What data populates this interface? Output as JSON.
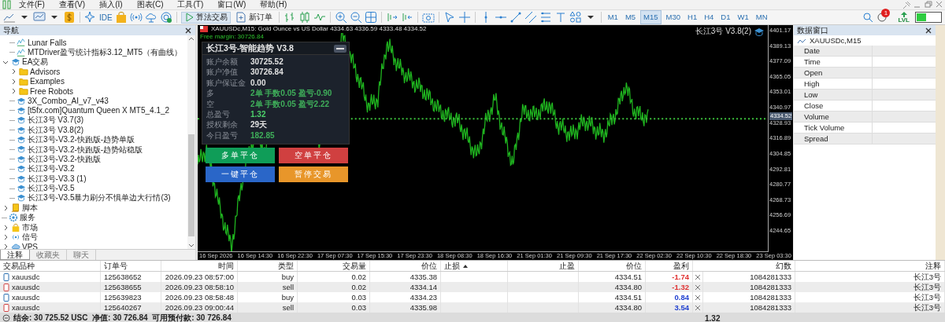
{
  "menu": [
    "文件(F)",
    "查看(V)",
    "插入(I)",
    "图表(C)",
    "工具(T)",
    "窗口(W)",
    "帮助(H)"
  ],
  "toolbar": {
    "ide": "IDE",
    "algo_trading": {
      "label": "算法交易",
      "on": true
    },
    "new_order": "新订单",
    "timeframes": [
      {
        "label": "M1",
        "selected": false
      },
      {
        "label": "M5",
        "selected": false
      },
      {
        "label": "M15",
        "selected": true
      },
      {
        "label": "M30",
        "selected": false
      },
      {
        "label": "H1",
        "selected": false
      },
      {
        "label": "H4",
        "selected": false
      },
      {
        "label": "D1",
        "selected": false
      },
      {
        "label": "W1",
        "selected": false
      },
      {
        "label": "MN",
        "selected": false
      }
    ],
    "notifications": "1",
    "level_badge": "LVL"
  },
  "navigator": {
    "title": "导航",
    "tree_continued": [
      {
        "label": "Lunar Falls",
        "kind": "indicator"
      },
      {
        "label": "MTDriver盈亏统计指标3.12_MT5（有曲线）",
        "kind": "indicator"
      }
    ],
    "tree": [
      {
        "label": "EA交易",
        "kind": "ea",
        "expanded": true,
        "children": [
          {
            "label": "Advisors",
            "kind": "folder",
            "expanded": false
          },
          {
            "label": "Examples",
            "kind": "folder",
            "expanded": false
          },
          {
            "label": "Free Robots",
            "kind": "folder",
            "expanded": false
          },
          {
            "label": "3X_Combo_AI_v7_v43",
            "kind": "ea"
          },
          {
            "label": "[t5fx.com]Quantum Queen X MT5_4.1_2",
            "kind": "ea"
          },
          {
            "label": "长江3号 V3.7(3)",
            "kind": "ea"
          },
          {
            "label": "长江3号 V3.8(2)",
            "kind": "ea"
          },
          {
            "label": "长江3号-V3.2-快跑版-趋势单版",
            "kind": "ea"
          },
          {
            "label": "长江3号-V3.2-快跑版-趋势站稳版",
            "kind": "ea"
          },
          {
            "label": "长江3号-V3.2-快跑版",
            "kind": "ea"
          },
          {
            "label": "长江3号-V3.2",
            "kind": "ea"
          },
          {
            "label": "长江3号-V3.3 (1)",
            "kind": "ea"
          },
          {
            "label": "长江3号-V3.5",
            "kind": "ea"
          },
          {
            "label": "长江3号-V3.5暴力刷分不惧单边大行情(3)",
            "kind": "ea"
          }
        ]
      },
      {
        "label": "脚本",
        "kind": "script",
        "expanded": false
      },
      {
        "label": "服务",
        "kind": "service"
      },
      {
        "label": "市场",
        "kind": "market",
        "expanded": false
      },
      {
        "label": "信号",
        "kind": "signal",
        "expanded": false
      },
      {
        "label": "VPS",
        "kind": "vps",
        "expanded": false
      }
    ],
    "tabs": [
      {
        "label": "注释",
        "selected": true
      },
      {
        "label": "收藏夹",
        "selected": false
      },
      {
        "label": "聊天",
        "selected": false
      }
    ]
  },
  "chart": {
    "header": "XAUUSDc,M15: Gold Ounce vs US Dollar  4334.63 4336.59 4333.48 4334.52",
    "free_margin": "Free margin: 30726.84",
    "ea_label": "长江3号 V3.8(2)",
    "price_ticks": [
      "4401.17",
      "4389.13",
      "4377.09",
      "4365.05",
      "4353.01",
      "4340.97",
      "4328.93",
      "4316.89",
      "4304.85",
      "4292.81",
      "4280.77",
      "4268.73",
      "4256.69",
      "4244.65"
    ],
    "current_price": "4334.52",
    "time_ticks": [
      "16 Sep 2026",
      "16 Sep 14:30",
      "16 Sep 22:30",
      "17 Sep 07:30",
      "17 Sep 15:30",
      "17 Sep 23:30",
      "18 Sep 08:30",
      "18 Sep 16:30",
      "21 Sep 01:30",
      "21 Sep 09:30",
      "21 Sep 17:30",
      "22 Sep 02:30",
      "22 Sep 10:30",
      "22 Sep 18:30",
      "23 Sep 03:30"
    ],
    "ea_panel": {
      "title": "长江3号-智能趋势 V3.8",
      "rows": [
        {
          "label": "账户余额",
          "value": "30725.52",
          "color": "#e0e0e0"
        },
        {
          "label": "账户净值",
          "value": "30726.84",
          "color": "#e0e0e0"
        },
        {
          "label": "账户保证金",
          "value": "0.00",
          "color": "#e0e0e0"
        },
        {
          "label": "多",
          "value": "2单 手数0.05 盈亏-0.90",
          "color": "#3fae5a"
        },
        {
          "label": "空",
          "value": "2单 手数0.05 盈亏2.22",
          "color": "#3fae5a"
        },
        {
          "label": "总盈亏",
          "value": "1.32",
          "color": "#4cd06a"
        },
        {
          "label": "授权剩余",
          "value": "29天",
          "color": "#e0e0e0"
        },
        {
          "label": "今日盈亏",
          "value": "182.85",
          "color": "#3fae5a"
        }
      ],
      "buttons": [
        {
          "label": "多单平仓",
          "color": "#0f9d58"
        },
        {
          "label": "空单平仓",
          "color": "#d04040"
        },
        {
          "label": "一键平仓",
          "color": "#2a66c8"
        },
        {
          "label": "暂停交易",
          "color": "#e8962a"
        }
      ]
    }
  },
  "data_window": {
    "title": "数据窗口",
    "symbol": "XAUUSDc,M15",
    "rows": [
      "Date",
      "Time",
      "Open",
      "High",
      "Low",
      "Close",
      "Volume",
      "Tick Volume",
      "Spread"
    ]
  },
  "trade_table": {
    "columns": [
      {
        "label": "交易品种",
        "sorted": false
      },
      {
        "label": "订单号",
        "sorted": false
      },
      {
        "label": "时间",
        "sorted": false
      },
      {
        "label": "类型",
        "sorted": false
      },
      {
        "label": "交易量",
        "sorted": false
      },
      {
        "label": "价位",
        "sorted": false
      },
      {
        "label": "止损",
        "sorted": true
      },
      {
        "label": "止盈",
        "sorted": false
      },
      {
        "label": "价位",
        "sorted": false
      },
      {
        "label": "盈利",
        "sorted": false
      },
      {
        "label": "幻数",
        "sorted": false
      },
      {
        "label": "注释",
        "sorted": false
      }
    ],
    "rows": [
      {
        "symbol": "xauusdc",
        "order": "125638652",
        "time": "2026.09.23 08:57:00",
        "type": "buy",
        "volume": "0.02",
        "price": "4335.38",
        "current": "4334.51",
        "profit": "-1.74",
        "color": "#e03030",
        "magic": "1084281333",
        "comment": "长江3号"
      },
      {
        "symbol": "xauusdc",
        "order": "125638655",
        "time": "2026.09.23 08:58:10",
        "type": "sell",
        "volume": "0.02",
        "price": "4334.14",
        "current": "4334.80",
        "profit": "-1.32",
        "color": "#e03030",
        "magic": "1084281333",
        "comment": "长江3号"
      },
      {
        "symbol": "xauusdc",
        "order": "125639823",
        "time": "2026.09.23 08:58:48",
        "type": "buy",
        "volume": "0.03",
        "price": "4334.23",
        "current": "4334.51",
        "profit": "0.84",
        "color": "#2040d0",
        "magic": "1084281333",
        "comment": "长江3号"
      },
      {
        "symbol": "xauusdc",
        "order": "125640267",
        "time": "2026.09.23 09:00:44",
        "type": "sell",
        "volume": "0.03",
        "price": "4335.98",
        "current": "4334.80",
        "profit": "3.54",
        "color": "#2040d0",
        "magic": "1084281333",
        "comment": "长江3号"
      }
    ],
    "summary": "结余: 30 725.52 USC  净值: 30 726.84  可用预付款: 30 726.84",
    "total_profit": "1.32"
  }
}
